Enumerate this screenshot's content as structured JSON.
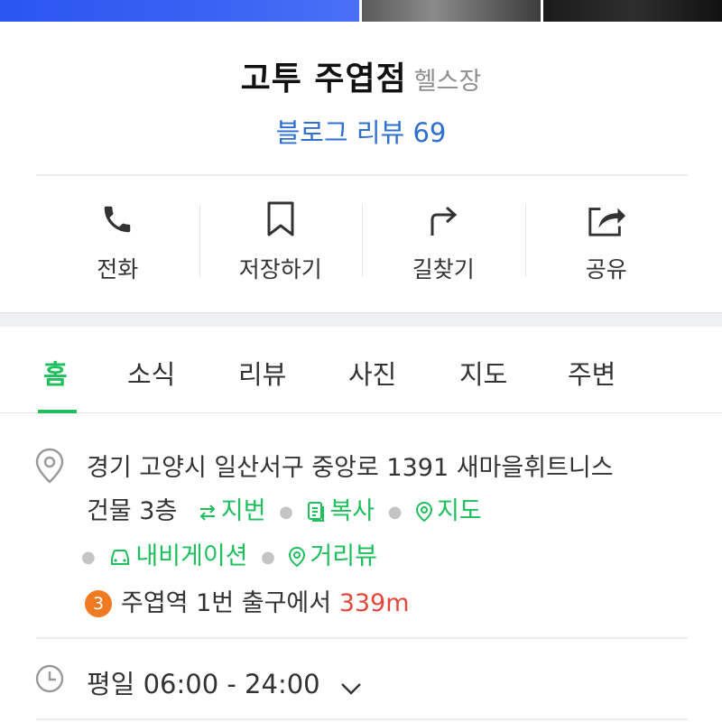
{
  "place": {
    "name": "고투 주엽점",
    "category": "헬스장",
    "blog_review_label": "블로그 리뷰 69"
  },
  "actions": [
    {
      "label": "전화",
      "icon": "phone-icon"
    },
    {
      "label": "저장하기",
      "icon": "bookmark-icon"
    },
    {
      "label": "길찾기",
      "icon": "directions-icon"
    },
    {
      "label": "공유",
      "icon": "share-icon"
    }
  ],
  "tabs": [
    {
      "label": "홈",
      "active": true
    },
    {
      "label": "소식",
      "active": false
    },
    {
      "label": "리뷰",
      "active": false
    },
    {
      "label": "사진",
      "active": false
    },
    {
      "label": "지도",
      "active": false
    },
    {
      "label": "주변",
      "active": false
    }
  ],
  "address": {
    "line1": "경기 고양시 일산서구 중앙로 1391 새마을휘트니스",
    "line2": "건물 3층",
    "jibun": "지번",
    "copy": "복사",
    "map": "지도",
    "navigation": "내비게이션",
    "street_view": "거리뷰"
  },
  "subway": {
    "line_number": "3",
    "station": "주엽역",
    "exit": "1번 출구에서",
    "distance": "339m",
    "line_color": "#f07a22"
  },
  "hours": {
    "text": "평일 06:00 - 24:00"
  },
  "colors": {
    "accent_green": "#1fbf5d",
    "link_blue": "#2f6fd0",
    "distance_red": "#e6453c"
  }
}
